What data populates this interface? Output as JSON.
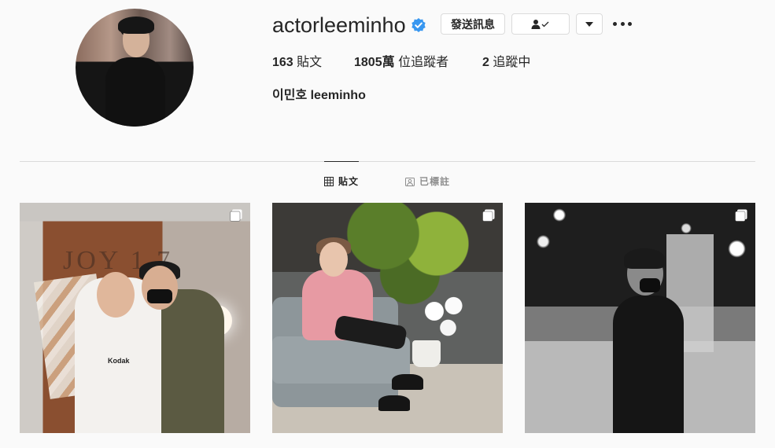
{
  "profile": {
    "username": "actorleeminho",
    "verified": true,
    "buttons": {
      "message": "發送訊息",
      "following_icon": "person-check-icon",
      "dropdown_icon": "caret-down-icon",
      "more_icon": "more-horizontal-icon"
    },
    "stats": {
      "posts_count": "163",
      "posts_label": "貼文",
      "followers_count": "1805萬",
      "followers_label": "位追蹤者",
      "following_count": "2",
      "following_label": "追蹤中"
    },
    "full_name": "이민호 leeminho"
  },
  "tabs": [
    {
      "label": "貼文",
      "icon": "grid-icon",
      "active": true
    },
    {
      "label": "已標註",
      "icon": "tagged-icon",
      "active": false
    }
  ],
  "posts": [
    {
      "type": "carousel",
      "icon": "multiple-photos-icon",
      "wall_text": "JOY 1 7",
      "shirt_text": "Kodak"
    },
    {
      "type": "carousel",
      "icon": "multiple-photos-icon"
    },
    {
      "type": "carousel",
      "icon": "multiple-photos-icon"
    }
  ],
  "colors": {
    "background": "#fafafa",
    "text": "#262626",
    "muted": "#8e8e8e",
    "border": "#dbdbdb",
    "verified": "#3897f0"
  }
}
